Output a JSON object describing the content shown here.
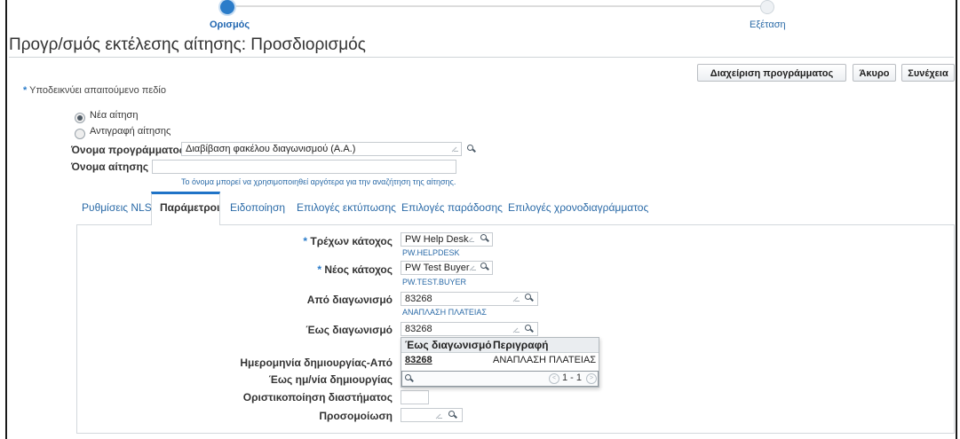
{
  "train": {
    "steps": [
      {
        "label": "Ορισμός",
        "active": true
      },
      {
        "label": "Εξέταση",
        "active": false
      }
    ]
  },
  "page": {
    "title": "Προγρ/σμός εκτέλεσης αίτησης: Προσδιορισμός"
  },
  "buttons": {
    "manage": "Διαχείριση προγράμματος",
    "cancel": "Άκυρο",
    "continue": "Συνέχεια"
  },
  "required_note": {
    "star": "*",
    "text": "Υποδεικνύει απαιτούμενο πεδίο"
  },
  "radios": {
    "new_request": {
      "label": "Νέα αίτηση",
      "selected": true
    },
    "copy_request": {
      "label": "Αντιγραφή αίτησης",
      "selected": false
    }
  },
  "program": {
    "label": "Όνομα προγράμματος",
    "value": "Διαβίβαση φακέλου διαγωνισμού (Α.Α.)"
  },
  "request_name": {
    "label": "Όνομα αίτησης",
    "value": "",
    "hint": "Το όνομα μπορεί να χρησιμοποιηθεί αργότερα για την αναζήτηση της αίτησης."
  },
  "tabs": [
    {
      "label": "Ρυθμίσεις NLS",
      "active": false
    },
    {
      "label": "Παράμετροι",
      "active": true
    },
    {
      "label": "Ειδοποίηση",
      "active": false
    },
    {
      "label": "Επιλογές εκτύπωσης",
      "active": false
    },
    {
      "label": "Επιλογές παράδοσης",
      "active": false
    },
    {
      "label": "Επιλογές χρονοδιαγράμματος",
      "active": false
    }
  ],
  "params": {
    "current_owner": {
      "label": "Τρέχων κάτοχος",
      "required": true,
      "value": "PW Help Desk",
      "sub": "PW.HELPDESK"
    },
    "new_owner": {
      "label": "Νέος κάτοχος",
      "required": true,
      "value": "PW Test Buyer",
      "sub": "PW.TEST.BUYER"
    },
    "from_tender": {
      "label": "Από διαγωνισμό",
      "value": "83268",
      "sub": "ΑΝΑΠΛΑΣΗ ΠΛΑΤΕΙΑΣ"
    },
    "to_tender": {
      "label": "Έως διαγωνισμό",
      "value": "83268"
    },
    "created_from": {
      "label": "Ημερομηνία δημιουργίας-Από"
    },
    "created_to": {
      "label": "Έως ημ/νία δημιουργίας"
    },
    "interval": {
      "label": "Οριστικοποίηση διαστήματος"
    },
    "simulation": {
      "label": "Προσομοίωση"
    }
  },
  "lov": {
    "col1": "Έως διαγωνισμό",
    "col2": "Περιγραφή",
    "rows": [
      {
        "id": "83268",
        "desc": "ΑΝΑΠΛΑΣΗ ΠΛΑΤΕΙΑΣ"
      }
    ],
    "range": "1 - 1",
    "prev_symbol": "<",
    "next_symbol": ">"
  }
}
